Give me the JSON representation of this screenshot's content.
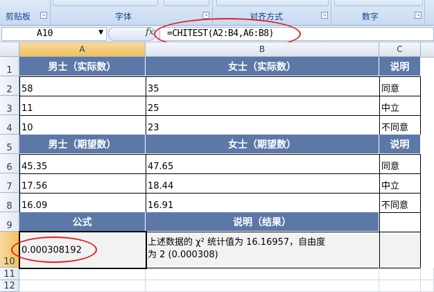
{
  "ribbon": {
    "groups": [
      {
        "label": "剪贴板"
      },
      {
        "label": "字体"
      },
      {
        "label": "对齐方式"
      },
      {
        "label": "数字"
      }
    ]
  },
  "formula_bar": {
    "name_box": "A10",
    "fx": "fx",
    "formula": "=CHITEST(A2:B4,A6:B8)"
  },
  "columns": [
    "A",
    "B",
    "C"
  ],
  "rows": [
    {
      "num": "1",
      "a": "男士（实际数）",
      "b": "女士（实际数）",
      "c": "说明"
    },
    {
      "num": "2",
      "a": "58",
      "b": "35",
      "c": "同意"
    },
    {
      "num": "3",
      "a": "11",
      "b": "25",
      "c": "中立"
    },
    {
      "num": "4",
      "a": "10",
      "b": "23",
      "c": "不同意"
    },
    {
      "num": "5",
      "a": "男士（期望数）",
      "b": "女士（期望数）",
      "c": "说明"
    },
    {
      "num": "6",
      "a": "45.35",
      "b": "47.65",
      "c": "同意"
    },
    {
      "num": "7",
      "a": "17.56",
      "b": "18.44",
      "c": "中立"
    },
    {
      "num": "8",
      "a": "16.09",
      "b": "16.91",
      "c": "不同意"
    },
    {
      "num": "9",
      "a": "公式",
      "b": "说明（结果）",
      "c": ""
    },
    {
      "num": "10",
      "a": "0.000308192",
      "b_line1": "上述数据的 χ² 统计值为 16.16957，自由度",
      "b_line2": "为 2 (0.000308)",
      "c": ""
    },
    {
      "num": "11"
    },
    {
      "num": "12"
    }
  ],
  "colors": {
    "header_fill": "#5b78a7",
    "annotation": "#e02020"
  }
}
